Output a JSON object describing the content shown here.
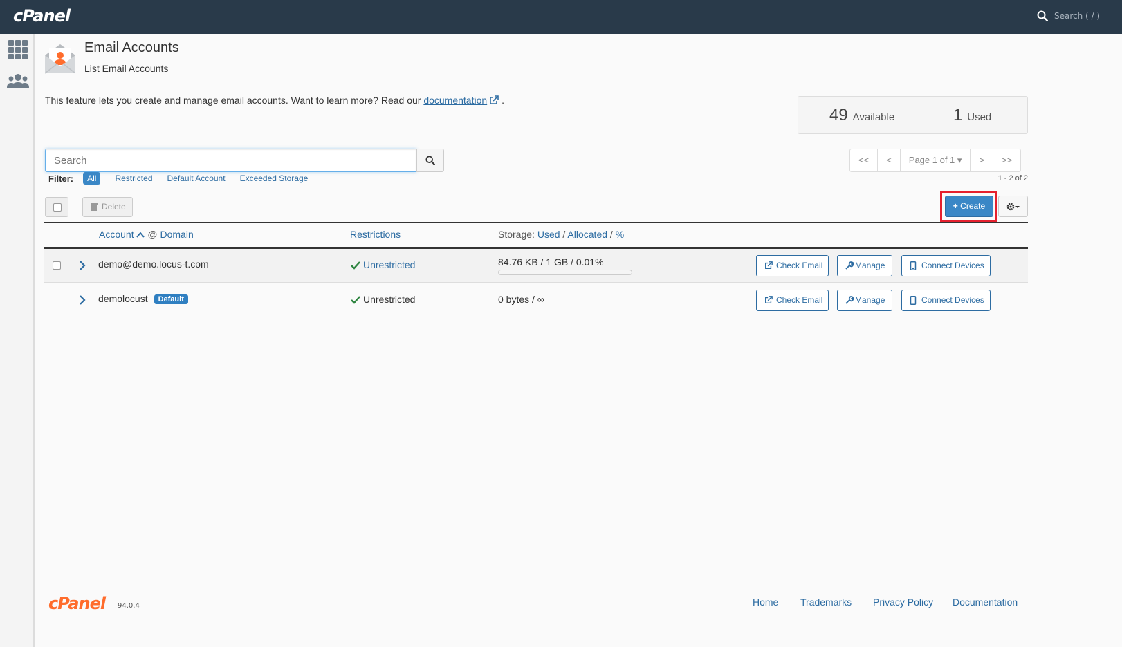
{
  "topbar": {
    "logo": "cPanel",
    "search_placeholder": "Search ( / )"
  },
  "sidebar": {
    "items": [
      {
        "icon": "apps-grid-icon"
      },
      {
        "icon": "users-icon"
      }
    ]
  },
  "header": {
    "title": "Email Accounts",
    "subtitle": "List Email Accounts",
    "icon": "email-accounts-icon"
  },
  "intro": {
    "text": "This feature lets you create and manage email accounts. Want to learn more? Read our",
    "link": "documentation",
    "suffix": "."
  },
  "stats": {
    "available_num": "49",
    "available_label": "Available",
    "used_num": "1",
    "used_label": "Used"
  },
  "search": {
    "placeholder": "Search"
  },
  "pager": {
    "first": "<<",
    "prev": "<",
    "page": "Page 1 of 1",
    "next": ">",
    "last": ">>",
    "range": "1 - 2 of 2"
  },
  "filter": {
    "label": "Filter:",
    "options": [
      "All",
      "Restricted",
      "Default Account",
      "Exceeded Storage"
    ],
    "active": "All"
  },
  "toolbar": {
    "delete": "Delete",
    "create": "Create"
  },
  "table": {
    "headers": {
      "account": "Account",
      "at": "@",
      "domain": "Domain",
      "restrictions": "Restrictions",
      "storage_prefix": "Storage:",
      "used": "Used",
      "allocated": "Allocated",
      "percent": "%",
      "sep": "/"
    },
    "rows": [
      {
        "account": "demo@demo.locus-t.com",
        "badge": "",
        "restriction": "Unrestricted",
        "storage": "84.76 KB / 1 GB / 0.01%",
        "usage_fraction": 0.0001
      },
      {
        "account": "demolocust",
        "badge": "Default",
        "restriction": "Unrestricted",
        "storage": "0 bytes / ∞"
      }
    ],
    "actions": {
      "check_email": "Check Email",
      "manage": "Manage",
      "connect_devices": "Connect Devices"
    }
  },
  "footer": {
    "logo": "cPanel",
    "version": "94.0.4",
    "links": [
      "Home",
      "Trademarks",
      "Privacy Policy",
      "Documentation"
    ]
  },
  "colors": {
    "topbar": "#293a4a",
    "accent": "#3a87c6",
    "link": "#2d6ca2",
    "success": "#2e8540",
    "highlight": "#e5202e",
    "brand_orange": "#ff6c2c"
  }
}
